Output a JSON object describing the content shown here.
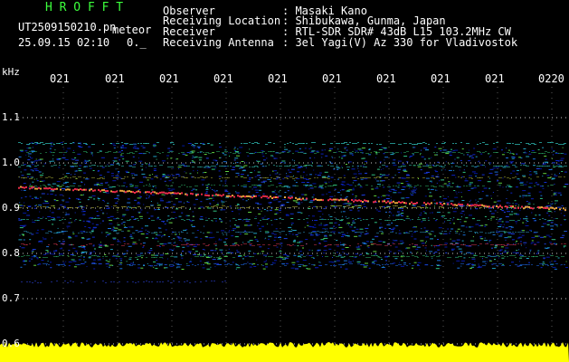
{
  "header": {
    "app_name": "H R O F F T",
    "filename": "UT2509150210.pn",
    "mode": "meteor",
    "date_time": "25.09.15 02:10",
    "count": "0._"
  },
  "info": {
    "labels": [
      "Observer",
      "Receiving Location",
      "Receiver",
      "Receiving Antenna"
    ],
    "values": [
      ": Masaki Kano",
      ": Shibukawa, Gunma, Japan",
      ": RTL-SDR SDR# 43dB L15 103.2MHz CW",
      ": 3el Yagi(V) Az 330 for Vladivostok"
    ]
  },
  "axis": {
    "unit": "kHz",
    "y_ticks": [
      "1.1",
      "1.0",
      "0.9",
      "0.8",
      "0.7",
      "0.6"
    ],
    "time_labels": [
      "021",
      "021",
      "021",
      "021",
      "021",
      "021",
      "021",
      "021",
      "021",
      "0220"
    ]
  },
  "colors": {
    "title_green": "#3cff3c",
    "text": "#ffffff",
    "signal_yellow": "#ffff00",
    "grid_dot": "#ffffff"
  }
}
